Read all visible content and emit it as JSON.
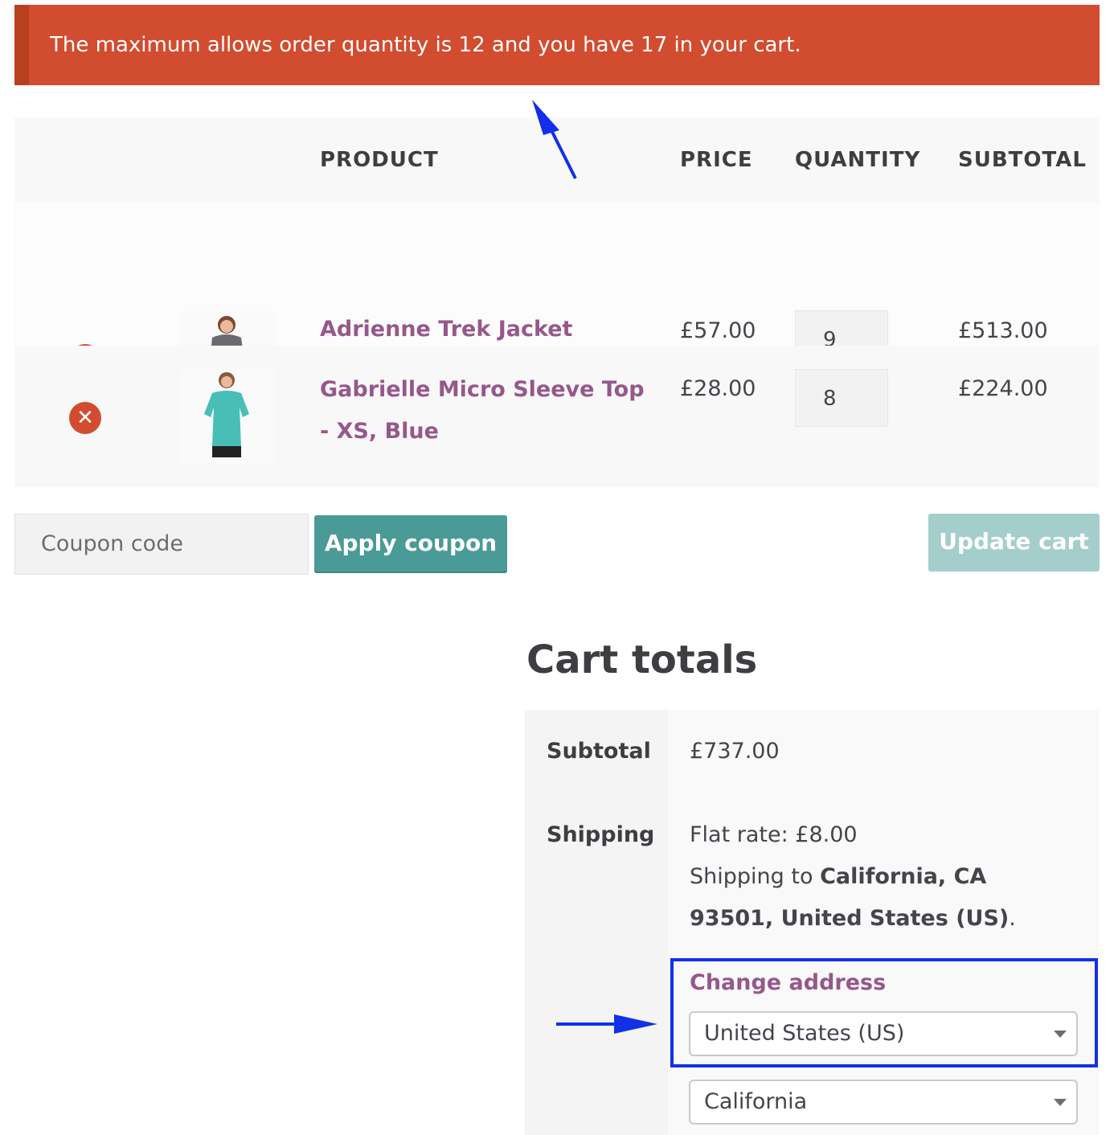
{
  "notice": {
    "message": "The maximum allows order quantity is 12 and you have 17 in your cart."
  },
  "cart": {
    "headers": {
      "product": "PRODUCT",
      "price": "PRICE",
      "quantity": "QUANTITY",
      "subtotal": "SUBTOTAL"
    },
    "items": [
      {
        "name": "Adrienne Trek Jacket",
        "price": "£57.00",
        "quantity": "9",
        "subtotal": "£513.00"
      },
      {
        "name": "Gabrielle Micro Sleeve Top - XS, Blue",
        "price": "£28.00",
        "quantity": "8",
        "subtotal": "£224.00"
      }
    ],
    "remove_glyph": "✕"
  },
  "actions": {
    "coupon_placeholder": "Coupon code",
    "apply_coupon": "Apply coupon",
    "update_cart": "Update cart"
  },
  "totals": {
    "title": "Cart totals",
    "subtotal_label": "Subtotal",
    "subtotal_value": "£737.00",
    "shipping_label": "Shipping",
    "flat_rate": "Flat rate: £8.00",
    "shipping_to_prefix": "Shipping to ",
    "shipping_destination": "California, CA 93501, United States (US)",
    "shipping_to_suffix": ".",
    "change_address": "Change address",
    "country_selected": "United States (US)",
    "state_selected": "California"
  },
  "colors": {
    "notice_bg": "#d24c2f",
    "link_purple": "#96588a",
    "button_teal": "#4a9a97",
    "button_disabled": "#a4cecb",
    "annotation_blue": "#1230e8"
  }
}
